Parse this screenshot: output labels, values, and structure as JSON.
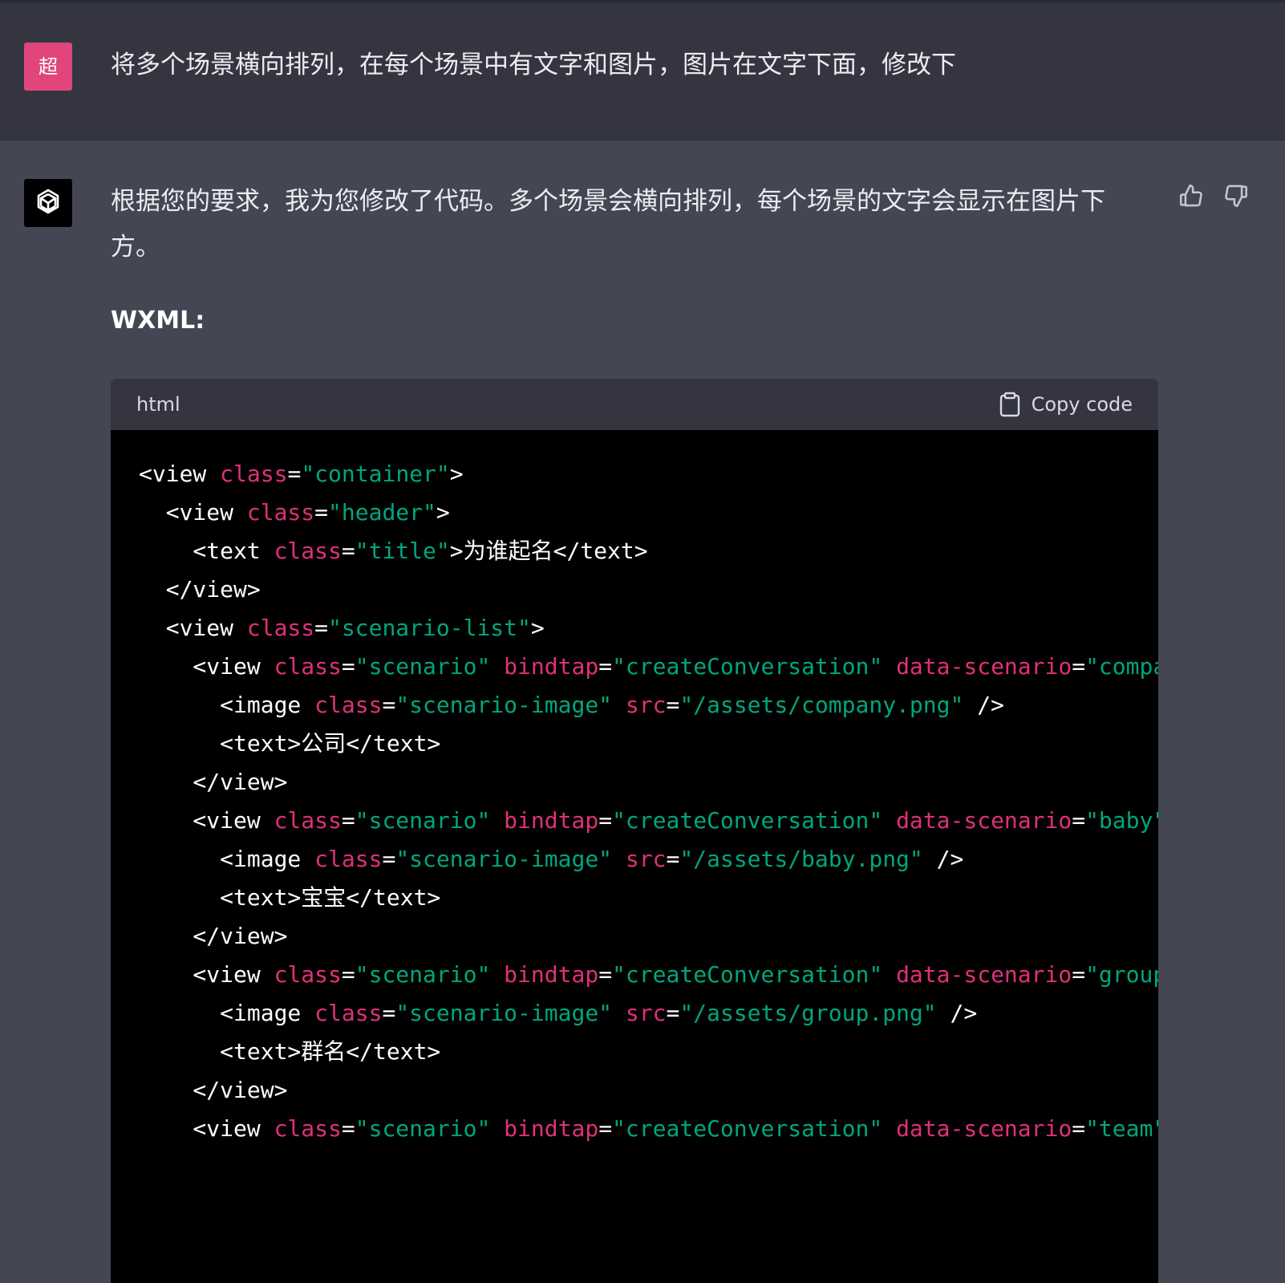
{
  "user_message": {
    "avatar_label": "超",
    "text": "将多个场景横向排列，在每个场景中有文字和图片，图片在文字下面，修改下"
  },
  "assistant_message": {
    "text": "根据您的要求，我为您修改了代码。多个场景会横向排列，每个场景的文字会显示在图片下方。",
    "section_heading": "WXML:",
    "code_block": {
      "language": "html",
      "copy_label": "Copy code",
      "lines": [
        [
          {
            "t": "p",
            "v": "<view "
          },
          {
            "t": "a",
            "v": "class"
          },
          {
            "t": "p",
            "v": "="
          },
          {
            "t": "s",
            "v": "\"container\""
          },
          {
            "t": "p",
            "v": ">"
          }
        ],
        [
          {
            "t": "p",
            "v": "  <view "
          },
          {
            "t": "a",
            "v": "class"
          },
          {
            "t": "p",
            "v": "="
          },
          {
            "t": "s",
            "v": "\"header\""
          },
          {
            "t": "p",
            "v": ">"
          }
        ],
        [
          {
            "t": "p",
            "v": "    <text "
          },
          {
            "t": "a",
            "v": "class"
          },
          {
            "t": "p",
            "v": "="
          },
          {
            "t": "s",
            "v": "\"title\""
          },
          {
            "t": "p",
            "v": ">为谁起名</text>"
          }
        ],
        [
          {
            "t": "p",
            "v": "  </view>"
          }
        ],
        [
          {
            "t": "p",
            "v": "  <view "
          },
          {
            "t": "a",
            "v": "class"
          },
          {
            "t": "p",
            "v": "="
          },
          {
            "t": "s",
            "v": "\"scenario-list\""
          },
          {
            "t": "p",
            "v": ">"
          }
        ],
        [
          {
            "t": "p",
            "v": "    <view "
          },
          {
            "t": "a",
            "v": "class"
          },
          {
            "t": "p",
            "v": "="
          },
          {
            "t": "s",
            "v": "\"scenario\""
          },
          {
            "t": "p",
            "v": " "
          },
          {
            "t": "a",
            "v": "bindtap"
          },
          {
            "t": "p",
            "v": "="
          },
          {
            "t": "s",
            "v": "\"createConversation\""
          },
          {
            "t": "p",
            "v": " "
          },
          {
            "t": "a",
            "v": "data-scenario"
          },
          {
            "t": "p",
            "v": "="
          },
          {
            "t": "s",
            "v": "\"compa"
          }
        ],
        [
          {
            "t": "p",
            "v": "      <image "
          },
          {
            "t": "a",
            "v": "class"
          },
          {
            "t": "p",
            "v": "="
          },
          {
            "t": "s",
            "v": "\"scenario-image\""
          },
          {
            "t": "p",
            "v": " "
          },
          {
            "t": "a",
            "v": "src"
          },
          {
            "t": "p",
            "v": "="
          },
          {
            "t": "s",
            "v": "\"/assets/company.png\""
          },
          {
            "t": "p",
            "v": " />"
          }
        ],
        [
          {
            "t": "p",
            "v": "      <text>公司</text>"
          }
        ],
        [
          {
            "t": "p",
            "v": "    </view>"
          }
        ],
        [
          {
            "t": "p",
            "v": "    <view "
          },
          {
            "t": "a",
            "v": "class"
          },
          {
            "t": "p",
            "v": "="
          },
          {
            "t": "s",
            "v": "\"scenario\""
          },
          {
            "t": "p",
            "v": " "
          },
          {
            "t": "a",
            "v": "bindtap"
          },
          {
            "t": "p",
            "v": "="
          },
          {
            "t": "s",
            "v": "\"createConversation\""
          },
          {
            "t": "p",
            "v": " "
          },
          {
            "t": "a",
            "v": "data-scenario"
          },
          {
            "t": "p",
            "v": "="
          },
          {
            "t": "s",
            "v": "\"baby\""
          }
        ],
        [
          {
            "t": "p",
            "v": "      <image "
          },
          {
            "t": "a",
            "v": "class"
          },
          {
            "t": "p",
            "v": "="
          },
          {
            "t": "s",
            "v": "\"scenario-image\""
          },
          {
            "t": "p",
            "v": " "
          },
          {
            "t": "a",
            "v": "src"
          },
          {
            "t": "p",
            "v": "="
          },
          {
            "t": "s",
            "v": "\"/assets/baby.png\""
          },
          {
            "t": "p",
            "v": " />"
          }
        ],
        [
          {
            "t": "p",
            "v": "      <text>宝宝</text>"
          }
        ],
        [
          {
            "t": "p",
            "v": "    </view>"
          }
        ],
        [
          {
            "t": "p",
            "v": "    <view "
          },
          {
            "t": "a",
            "v": "class"
          },
          {
            "t": "p",
            "v": "="
          },
          {
            "t": "s",
            "v": "\"scenario\""
          },
          {
            "t": "p",
            "v": " "
          },
          {
            "t": "a",
            "v": "bindtap"
          },
          {
            "t": "p",
            "v": "="
          },
          {
            "t": "s",
            "v": "\"createConversation\""
          },
          {
            "t": "p",
            "v": " "
          },
          {
            "t": "a",
            "v": "data-scenario"
          },
          {
            "t": "p",
            "v": "="
          },
          {
            "t": "s",
            "v": "\"group"
          }
        ],
        [
          {
            "t": "p",
            "v": "      <image "
          },
          {
            "t": "a",
            "v": "class"
          },
          {
            "t": "p",
            "v": "="
          },
          {
            "t": "s",
            "v": "\"scenario-image\""
          },
          {
            "t": "p",
            "v": " "
          },
          {
            "t": "a",
            "v": "src"
          },
          {
            "t": "p",
            "v": "="
          },
          {
            "t": "s",
            "v": "\"/assets/group.png\""
          },
          {
            "t": "p",
            "v": " />"
          }
        ],
        [
          {
            "t": "p",
            "v": "      <text>群名</text>"
          }
        ],
        [
          {
            "t": "p",
            "v": "    </view>"
          }
        ],
        [
          {
            "t": "p",
            "v": "    <view "
          },
          {
            "t": "a",
            "v": "class"
          },
          {
            "t": "p",
            "v": "="
          },
          {
            "t": "s",
            "v": "\"scenario\""
          },
          {
            "t": "p",
            "v": " "
          },
          {
            "t": "a",
            "v": "bindtap"
          },
          {
            "t": "p",
            "v": "="
          },
          {
            "t": "s",
            "v": "\"createConversation\""
          },
          {
            "t": "p",
            "v": " "
          },
          {
            "t": "a",
            "v": "data-scenario"
          },
          {
            "t": "p",
            "v": "="
          },
          {
            "t": "s",
            "v": "\"team\""
          }
        ]
      ]
    }
  },
  "icons": {
    "user_avatar": "user-avatar",
    "assistant_avatar": "openai-logo-icon",
    "like": "thumbs-up-icon",
    "dislike": "thumbs-down-icon",
    "copy": "clipboard-icon"
  },
  "colors": {
    "user_bg": "#343541",
    "assistant_bg": "#444654",
    "user_avatar_bg": "#e0467c",
    "code_bg": "#000000",
    "code_attr": "#df3079",
    "code_string": "#00a67d"
  }
}
